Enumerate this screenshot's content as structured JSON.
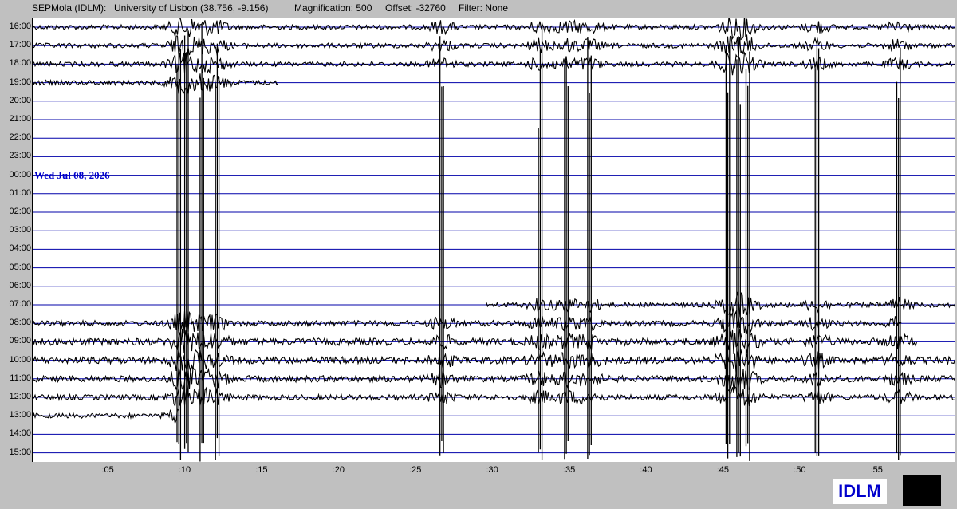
{
  "header": {
    "station": "SEPMola (IDLM):",
    "location": "University of Lisbon (38.756, -9.156)",
    "magnification": "Magnification: 500",
    "offset": "Offset: -32760",
    "filter": "Filter: None"
  },
  "date_label": "Wed Jul 08, 2026",
  "logo_text": "IDLM",
  "colors": {
    "background": "#c0c0c0",
    "gridline": "#0000aa",
    "trace": "#000000",
    "date_text": "#0000cc"
  },
  "chart_data": {
    "type": "line",
    "title": "",
    "xlabel": "",
    "ylabel": "",
    "x_ticks": [
      ":05",
      ":10",
      ":15",
      ":20",
      ":25",
      ":30",
      ":35",
      ":40",
      ":45",
      ":50",
      ":55"
    ],
    "y_ticks": [
      "16:00",
      "17:00",
      "18:00",
      "19:00",
      "20:00",
      "21:00",
      "22:00",
      "23:00",
      "00:00",
      "01:00",
      "02:00",
      "03:00",
      "04:00",
      "05:00",
      "06:00",
      "07:00",
      "08:00",
      "09:00",
      "10:00",
      "11:00",
      "12:00",
      "13:00",
      "14:00",
      "15:00"
    ],
    "xlim_minutes": [
      0,
      60
    ],
    "traces": [
      {
        "hour": "16:00",
        "start": 0,
        "end": 60,
        "amp": 3
      },
      {
        "hour": "17:00",
        "start": 0,
        "end": 60,
        "amp": 3
      },
      {
        "hour": "18:00",
        "start": 0,
        "end": 60,
        "amp": 3
      },
      {
        "hour": "19:00",
        "start": 0,
        "end": 16,
        "amp": 3
      },
      {
        "hour": "07:00",
        "start": 29.5,
        "end": 60,
        "amp": 3
      },
      {
        "hour": "08:00",
        "start": 0,
        "end": 56.5,
        "amp": 3.5
      },
      {
        "hour": "09:00",
        "start": 0,
        "end": 57.5,
        "amp": 4.5
      },
      {
        "hour": "10:00",
        "start": 0,
        "end": 60,
        "amp": 4.5
      },
      {
        "hour": "11:00",
        "start": 0,
        "end": 60,
        "amp": 4
      },
      {
        "hour": "12:00",
        "start": 0,
        "end": 60,
        "amp": 3.5
      },
      {
        "hour": "13:00",
        "start": 0,
        "end": 9.5,
        "amp": 3
      }
    ],
    "spikes_minutes": [
      9.5,
      10,
      11,
      12,
      26.6,
      33,
      34.7,
      36.2,
      45.2,
      45.9,
      46.5,
      51,
      56.3
    ]
  }
}
